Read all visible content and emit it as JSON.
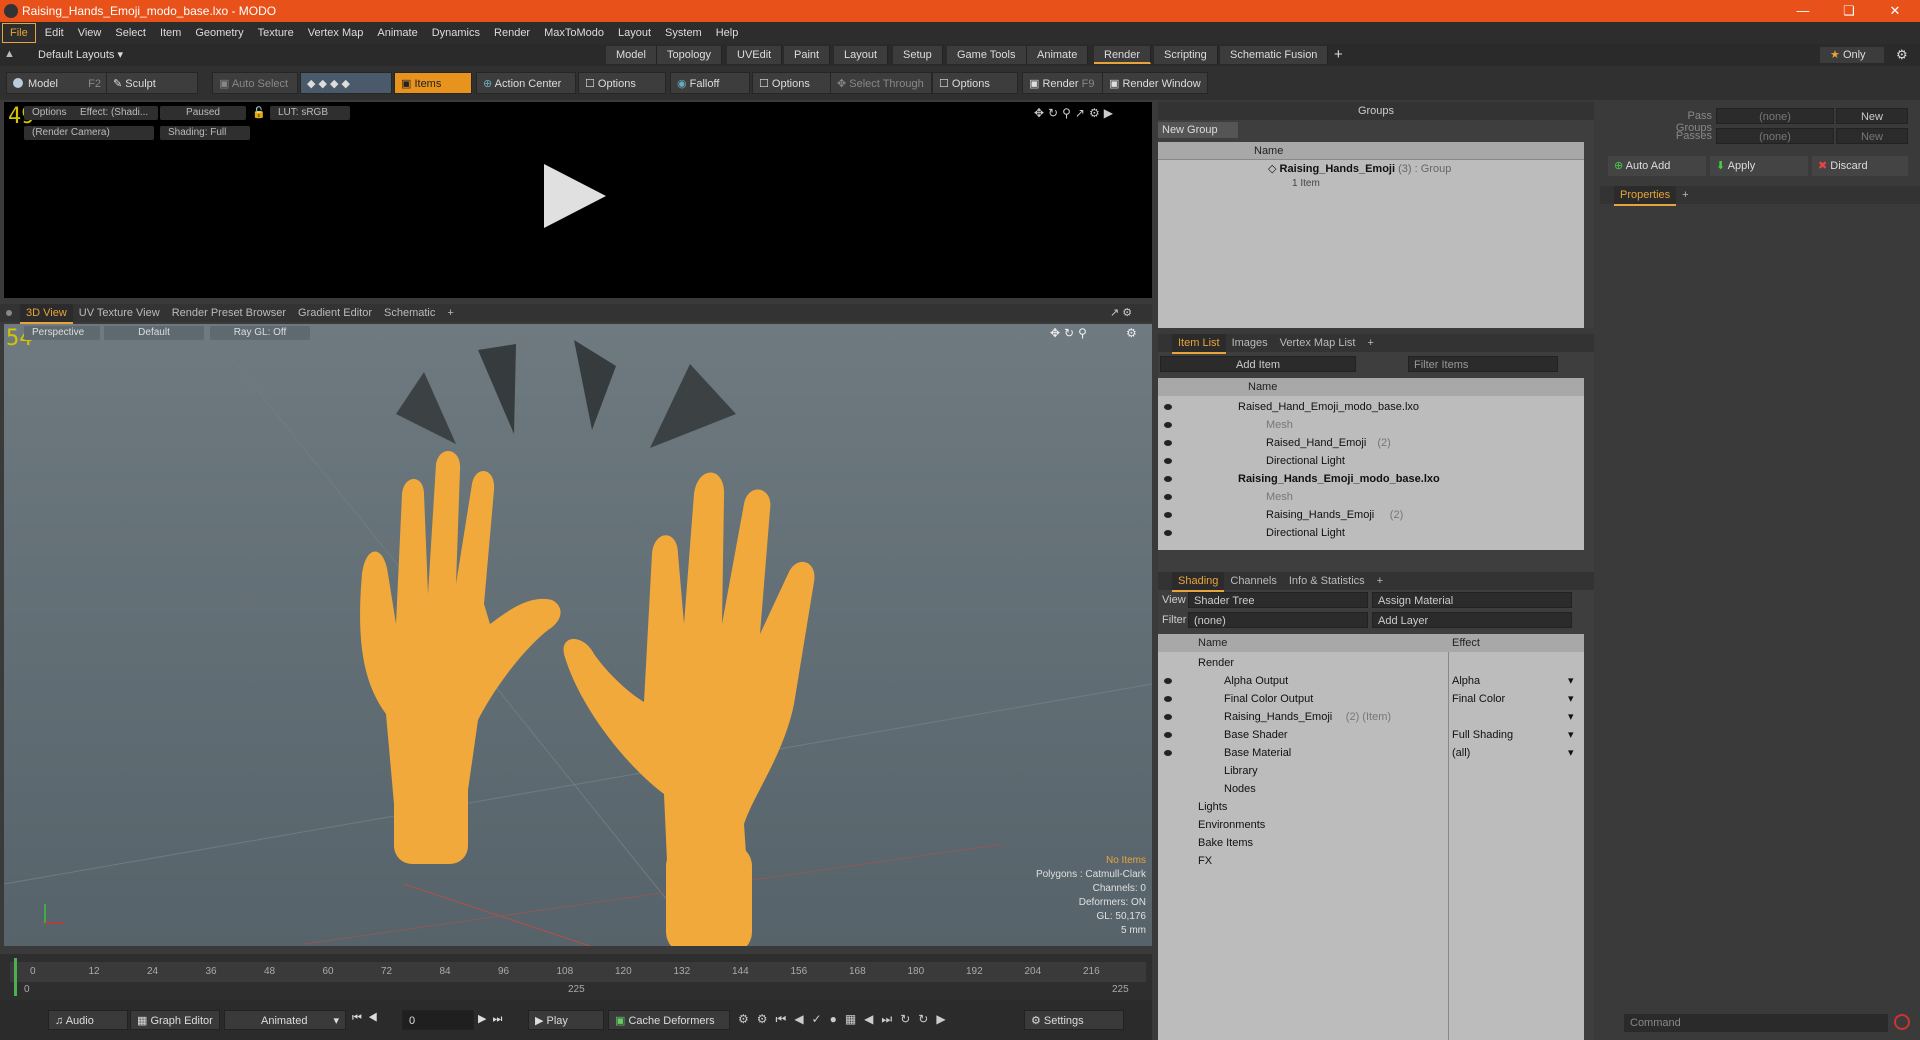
{
  "window": {
    "title": "Raising_Hands_Emoji_modo_base.lxo - MODO"
  },
  "menu": [
    "File",
    "Edit",
    "View",
    "Select",
    "Item",
    "Geometry",
    "Texture",
    "Vertex Map",
    "Animate",
    "Dynamics",
    "Render",
    "MaxToModo",
    "Layout",
    "System",
    "Help"
  ],
  "layout": {
    "preset": "Default Layouts ▾",
    "tabs": [
      "Model",
      "Topology",
      "UVEdit",
      "Paint",
      "Layout",
      "Setup",
      "Game Tools",
      "Animate",
      "Render",
      "Scripting",
      "Schematic Fusion"
    ],
    "selected": "Render",
    "only": "Only"
  },
  "toolbar": {
    "model": "Model",
    "model_key": "F2",
    "sculpt": "Sculpt",
    "auto_select": "Auto Select",
    "items": "Items",
    "action_center": "Action Center",
    "options": "Options",
    "falloff": "Falloff",
    "select_through": "Select Through",
    "render": "Render",
    "render_key": "F9",
    "render_window": "Render Window"
  },
  "render_view": {
    "fps": "49",
    "options": "Options",
    "effect": "Effect: (Shadi...",
    "paused": "Paused",
    "lut": "LUT: sRGB",
    "camera": "(Render Camera)",
    "shading": "Shading: Full"
  },
  "view_tabs": [
    "3D View",
    "UV Texture View",
    "Render Preset Browser",
    "Gradient Editor",
    "Schematic"
  ],
  "viewport": {
    "fps": "54",
    "perspective": "Perspective",
    "default": "Default",
    "raygl": "Ray GL: Off",
    "stats": [
      "No Items",
      "Polygons : Catmull-Clark",
      "Channels: 0",
      "Deformers: ON",
      "GL: 50,176",
      "5 mm"
    ]
  },
  "timeline": {
    "ticks": [
      "0",
      "12",
      "24",
      "36",
      "48",
      "60",
      "72",
      "84",
      "96",
      "108",
      "120",
      "132",
      "144",
      "156",
      "168",
      "180",
      "192",
      "204",
      "216"
    ],
    "start": "0",
    "end": "225",
    "mid": "225"
  },
  "bottom": {
    "audio": "Audio",
    "graph_editor": "Graph Editor",
    "animated": "Animated",
    "frame": "0",
    "play": "Play",
    "cache": "Cache Deformers",
    "settings": "Settings"
  },
  "groups": {
    "title": "Groups",
    "new_group": "New Group",
    "col_name": "Name",
    "item_name": "Raising_Hands_Emoji",
    "item_count": "(3)",
    "item_type": ": Group",
    "item_sub": "1 Item"
  },
  "item_list": {
    "tabs": [
      "Item List",
      "Images",
      "Vertex Map List"
    ],
    "add_item": "Add Item",
    "filter": "Filter Items",
    "col_name": "Name",
    "rows": [
      {
        "text": "Raised_Hand_Emoji_modo_base.lxo",
        "bold": false,
        "indent": 0,
        "dim": false
      },
      {
        "text": "Mesh",
        "bold": false,
        "indent": 2,
        "dim": true
      },
      {
        "text": "Raised_Hand_Emoji",
        "suffix": "(2)",
        "bold": false,
        "indent": 2,
        "dim": false
      },
      {
        "text": "Directional Light",
        "bold": false,
        "indent": 2,
        "dim": false
      },
      {
        "text": "Raising_Hands_Emoji_modo_base.lxo",
        "bold": true,
        "indent": 0,
        "dim": false
      },
      {
        "text": "Mesh",
        "bold": false,
        "indent": 2,
        "dim": true
      },
      {
        "text": "Raising_Hands_Emoji",
        "suffix": "(2)",
        "bold": false,
        "indent": 2,
        "dim": false
      },
      {
        "text": "Directional Light",
        "bold": false,
        "indent": 2,
        "dim": false
      }
    ]
  },
  "shading": {
    "tabs": [
      "Shading",
      "Channels",
      "Info & Statistics"
    ],
    "view_label": "View",
    "view_value": "Shader Tree",
    "assign": "Assign Material",
    "filter_label": "Filter",
    "filter_value": "(none)",
    "add_layer": "Add Layer",
    "col_name": "Name",
    "col_effect": "Effect",
    "rows": [
      {
        "name": "Render",
        "effect": "",
        "indent": 0
      },
      {
        "name": "Alpha Output",
        "effect": "Alpha",
        "indent": 1
      },
      {
        "name": "Final Color Output",
        "effect": "Final Color",
        "indent": 1
      },
      {
        "name": "Raising_Hands_Emoji",
        "suffix": "(2) (Item)",
        "effect": "",
        "indent": 1
      },
      {
        "name": "Base Shader",
        "effect": "Full Shading",
        "indent": 1
      },
      {
        "name": "Base Material",
        "effect": "(all)",
        "indent": 1
      },
      {
        "name": "Library",
        "effect": "",
        "indent": 1
      },
      {
        "name": "Nodes",
        "effect": "",
        "indent": 1
      },
      {
        "name": "Lights",
        "effect": "",
        "indent": 0
      },
      {
        "name": "Environments",
        "effect": "",
        "indent": 0
      },
      {
        "name": "Bake Items",
        "effect": "",
        "indent": 0
      },
      {
        "name": "FX",
        "effect": "",
        "indent": 0
      }
    ]
  },
  "passes": {
    "pass_groups": "Pass Groups",
    "passes": "Passes",
    "none": "(none)",
    "new": "New",
    "auto_add": "Auto Add",
    "apply": "Apply",
    "discard": "Discard",
    "properties": "Properties",
    "command": "Command"
  }
}
